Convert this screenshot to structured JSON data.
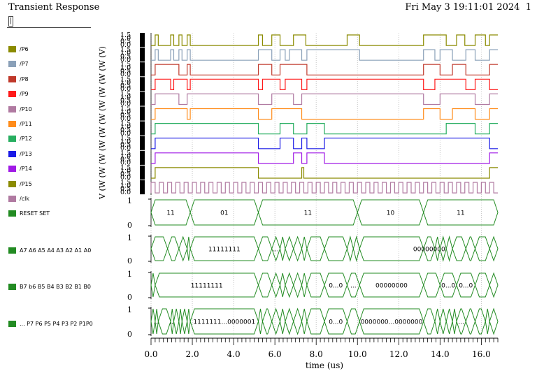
{
  "header": {
    "title": "Transient Response",
    "timestamp": "Fri May 3 19:11:01 2024",
    "page": "1"
  },
  "chart_data": {
    "type": "line",
    "title": "Transient Response",
    "xlabel": "time (us)",
    "xlim": [
      0,
      16.8
    ],
    "x_ticks": [
      "0.0",
      "2.0",
      "4.0",
      "6.0",
      "8.0",
      "10.0",
      "12.0",
      "14.0",
      "16.0"
    ],
    "analog_ylabel": "V (V)",
    "analog_ticks": [
      "1.5",
      "1.0",
      "0.5",
      "0.0"
    ],
    "bus_ticks": [
      "1",
      "0"
    ],
    "analog_series": [
      {
        "name": "/P6",
        "color": "#8b8b00",
        "levels": [
          [
            0,
            0
          ],
          [
            0.2,
            1
          ],
          [
            0.35,
            0
          ],
          [
            0.95,
            1
          ],
          [
            1.1,
            0
          ],
          [
            1.35,
            1
          ],
          [
            1.5,
            0
          ],
          [
            1.75,
            1
          ],
          [
            1.9,
            0
          ],
          [
            5.2,
            1
          ],
          [
            5.4,
            0
          ],
          [
            5.85,
            1
          ],
          [
            6.25,
            0
          ],
          [
            6.9,
            1
          ],
          [
            7.5,
            0
          ],
          [
            9.5,
            1
          ],
          [
            10.1,
            0
          ],
          [
            13.2,
            1
          ],
          [
            14.3,
            0
          ],
          [
            14.8,
            1
          ],
          [
            15.2,
            0
          ],
          [
            15.7,
            1
          ],
          [
            16.2,
            0
          ],
          [
            16.4,
            1
          ],
          [
            16.8,
            1
          ]
        ]
      },
      {
        "name": "/P7",
        "color": "#8aa0b8",
        "levels": [
          [
            0,
            0
          ],
          [
            0.2,
            1
          ],
          [
            0.35,
            0
          ],
          [
            0.95,
            1
          ],
          [
            1.1,
            0
          ],
          [
            1.35,
            1
          ],
          [
            1.5,
            0
          ],
          [
            1.75,
            1
          ],
          [
            1.9,
            0
          ],
          [
            5.2,
            1
          ],
          [
            5.85,
            0
          ],
          [
            6.25,
            1
          ],
          [
            6.5,
            0
          ],
          [
            6.7,
            1
          ],
          [
            7.3,
            0
          ],
          [
            7.55,
            1
          ],
          [
            10.1,
            0
          ],
          [
            13.2,
            1
          ],
          [
            13.75,
            0
          ],
          [
            14.0,
            1
          ],
          [
            14.6,
            0
          ],
          [
            15.25,
            1
          ],
          [
            15.7,
            0
          ],
          [
            16.4,
            1
          ],
          [
            16.8,
            1
          ]
        ]
      },
      {
        "name": "/P8",
        "color": "#c0392b",
        "levels": [
          [
            0,
            0
          ],
          [
            0.2,
            1
          ],
          [
            1.35,
            0
          ],
          [
            1.75,
            1
          ],
          [
            1.9,
            0
          ],
          [
            5.2,
            1
          ],
          [
            5.85,
            0
          ],
          [
            6.25,
            1
          ],
          [
            7.55,
            0
          ],
          [
            13.2,
            1
          ],
          [
            14.0,
            0
          ],
          [
            14.6,
            1
          ],
          [
            15.25,
            0
          ],
          [
            16.4,
            1
          ],
          [
            16.8,
            1
          ]
        ]
      },
      {
        "name": "/P9",
        "color": "#ff1a1a",
        "levels": [
          [
            0,
            0
          ],
          [
            0.2,
            1
          ],
          [
            0.95,
            0
          ],
          [
            1.1,
            1
          ],
          [
            1.75,
            0
          ],
          [
            1.9,
            1
          ],
          [
            5.2,
            0
          ],
          [
            5.4,
            1
          ],
          [
            6.25,
            0
          ],
          [
            6.5,
            1
          ],
          [
            7.3,
            0
          ],
          [
            7.55,
            1
          ],
          [
            13.2,
            0
          ],
          [
            13.75,
            1
          ],
          [
            15.25,
            0
          ],
          [
            15.7,
            1
          ],
          [
            16.4,
            0
          ],
          [
            16.8,
            0
          ]
        ]
      },
      {
        "name": "/P10",
        "color": "#b07aa1",
        "levels": [
          [
            0,
            0
          ],
          [
            0.2,
            1
          ],
          [
            1.35,
            0
          ],
          [
            1.75,
            1
          ],
          [
            5.2,
            0
          ],
          [
            5.85,
            1
          ],
          [
            6.9,
            0
          ],
          [
            7.3,
            1
          ],
          [
            13.2,
            0
          ],
          [
            14.0,
            1
          ],
          [
            15.7,
            0
          ],
          [
            16.4,
            1
          ],
          [
            16.8,
            1
          ]
        ]
      },
      {
        "name": "/P11",
        "color": "#ff8c1a",
        "levels": [
          [
            0,
            0
          ],
          [
            0.2,
            1
          ],
          [
            1.75,
            0
          ],
          [
            1.9,
            1
          ],
          [
            5.2,
            0
          ],
          [
            5.85,
            1
          ],
          [
            7.3,
            0
          ],
          [
            13.2,
            1
          ],
          [
            14.0,
            0
          ],
          [
            14.6,
            1
          ],
          [
            15.7,
            0
          ],
          [
            16.4,
            1
          ],
          [
            16.8,
            1
          ]
        ]
      },
      {
        "name": "/P12",
        "color": "#27ae60",
        "levels": [
          [
            0,
            0
          ],
          [
            0.2,
            1
          ],
          [
            5.2,
            0
          ],
          [
            6.25,
            1
          ],
          [
            6.9,
            0
          ],
          [
            7.55,
            1
          ],
          [
            8.4,
            0
          ],
          [
            14.3,
            1
          ],
          [
            15.7,
            0
          ],
          [
            16.4,
            1
          ],
          [
            16.8,
            1
          ]
        ]
      },
      {
        "name": "/P13",
        "color": "#1a1ae6",
        "levels": [
          [
            0,
            0
          ],
          [
            0.2,
            1
          ],
          [
            5.2,
            0
          ],
          [
            6.25,
            1
          ],
          [
            6.9,
            0
          ],
          [
            7.3,
            1
          ],
          [
            7.55,
            0
          ],
          [
            8.4,
            1
          ],
          [
            16.4,
            0
          ],
          [
            16.8,
            0
          ]
        ]
      },
      {
        "name": "/P14",
        "color": "#a01ae6",
        "levels": [
          [
            0,
            0
          ],
          [
            0.2,
            1
          ],
          [
            5.2,
            0
          ],
          [
            6.9,
            1
          ],
          [
            7.3,
            0
          ],
          [
            7.55,
            1
          ],
          [
            8.4,
            0
          ],
          [
            16.4,
            1
          ],
          [
            16.8,
            1
          ]
        ]
      },
      {
        "name": "/P15",
        "color": "#8b8b00",
        "levels": [
          [
            0,
            0
          ],
          [
            0.2,
            1
          ],
          [
            5.2,
            0
          ],
          [
            7.3,
            1
          ],
          [
            7.4,
            0
          ],
          [
            16.4,
            1
          ],
          [
            16.8,
            1
          ]
        ]
      },
      {
        "name": "/clk",
        "color": "#b07aa1",
        "clock_period": 0.4,
        "clock_duty": 0.5
      }
    ],
    "bus_series": [
      {
        "name": "RESET SET",
        "color": "#228b22",
        "transitions": [
          0,
          1.9,
          5.2,
          10.0,
          13.2,
          16.8
        ],
        "labels": [
          "11",
          "01",
          "11",
          "10",
          "11"
        ]
      },
      {
        "name": "A7 A6 A5 A4 A3 A2 A1 A0",
        "color": "#228b22",
        "transitions": [
          0,
          0.8,
          1.35,
          1.75,
          1.9,
          5.2,
          5.85,
          6.25,
          6.5,
          6.9,
          7.3,
          7.55,
          8.4,
          9.5,
          9.8,
          10.1,
          13.2,
          13.75,
          14.0,
          14.3,
          14.6,
          15.25,
          15.7,
          16.4,
          16.8
        ],
        "labels": [
          "",
          "",
          "",
          "",
          "11111111",
          "",
          "...",
          "",
          "",
          "",
          "",
          "",
          "",
          "",
          "",
          "",
          "00000000",
          "",
          "",
          "",
          "",
          "",
          "",
          "",
          ""
        ]
      },
      {
        "name": "B7 b6 B5 B4 B3 B2 B1 B0",
        "color": "#228b22",
        "transitions": [
          0,
          0.2,
          5.2,
          5.85,
          6.25,
          6.5,
          6.9,
          7.3,
          7.55,
          8.4,
          9.5,
          10.1,
          13.2,
          14.0,
          14.8,
          15.7,
          16.4,
          16.8
        ],
        "labels": [
          "",
          "11111111",
          "",
          "",
          "",
          "",
          "",
          "",
          "",
          "0...0",
          "...",
          "00000000",
          "",
          "0...0",
          "0...0",
          "",
          ""
        ]
      },
      {
        "name": "... P7 P6 P5 P4 P3 P2 P1P0",
        "color": "#228b22",
        "transitions": [
          0,
          0.2,
          0.35,
          0.95,
          1.1,
          1.35,
          1.5,
          1.75,
          1.9,
          5.2,
          5.4,
          5.85,
          6.25,
          6.5,
          6.9,
          7.3,
          7.55,
          8.4,
          9.5,
          10.1,
          13.2,
          13.75,
          14.0,
          14.3,
          14.6,
          14.8,
          15.25,
          15.7,
          16.2,
          16.4,
          16.8
        ],
        "labels": [
          "",
          "...",
          "",
          "...",
          "",
          "",
          "",
          "",
          "1111111...0000001",
          "",
          "",
          "",
          "",
          "",
          "",
          "",
          "",
          "0...0",
          "",
          "0000000...0000000",
          "",
          "",
          "",
          "",
          "",
          "...",
          "",
          "",
          "",
          "",
          ""
        ]
      }
    ]
  }
}
